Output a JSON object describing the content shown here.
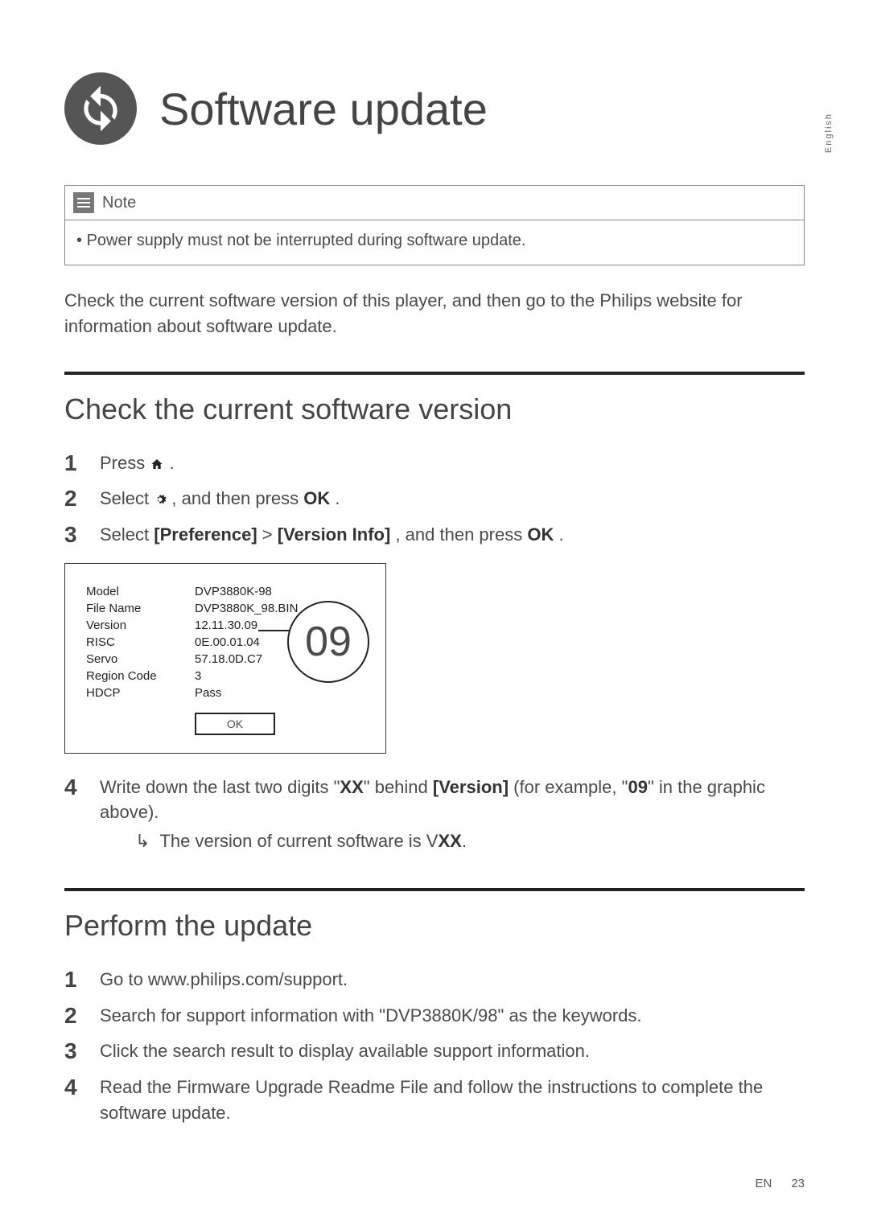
{
  "side_language": "English",
  "title": "Software update",
  "note": {
    "label": "Note",
    "body": "Power supply must not be interrupted during software update."
  },
  "lead": "Check the current software version of this player, and then go to the Philips website for information about software update.",
  "section_check": {
    "heading": "Check the current software version",
    "steps": {
      "s1_pre": "Press ",
      "s1_post": ".",
      "s2_pre": "Select ",
      "s2_mid": ", and then press ",
      "s2_ok": "OK",
      "s2_post": ".",
      "s3_pre": "Select ",
      "s3_pref": "[Preference]",
      "s3_gt": " > ",
      "s3_ver": "[Version Info]",
      "s3_mid": ", and then press ",
      "s3_ok": "OK",
      "s3_post": "."
    },
    "panel": {
      "rows": [
        {
          "label": "Model",
          "value": "DVP3880K-98"
        },
        {
          "label": "File Name",
          "value": "DVP3880K_98.BIN"
        },
        {
          "label": "Version",
          "value": "12.11.30.09"
        },
        {
          "label": "RISC",
          "value": "0E.00.01.04"
        },
        {
          "label": "Servo",
          "value": "57.18.0D.C7"
        },
        {
          "label": "Region Code",
          "value": "3"
        },
        {
          "label": "HDCP",
          "value": "Pass"
        }
      ],
      "ok": "OK",
      "callout": "09"
    },
    "step4": {
      "a": "Write down the last two digits \"",
      "xx1": "XX",
      "b": "\" behind ",
      "ver": "[Version]",
      "c": " (for example, \"",
      "ex": "09",
      "d": "\" in the graphic above).",
      "sub_pre": "The version of current software is V",
      "sub_xx": "XX",
      "sub_post": "."
    }
  },
  "section_perform": {
    "heading": "Perform the update",
    "steps": [
      "Go to www.philips.com/support.",
      "Search for support information with \"DVP3880K/98\" as the keywords.",
      "Click the search result to display available support information.",
      "Read the Firmware Upgrade Readme File and follow the instructions to complete the software update."
    ]
  },
  "footer": {
    "lang": "EN",
    "page": "23"
  }
}
